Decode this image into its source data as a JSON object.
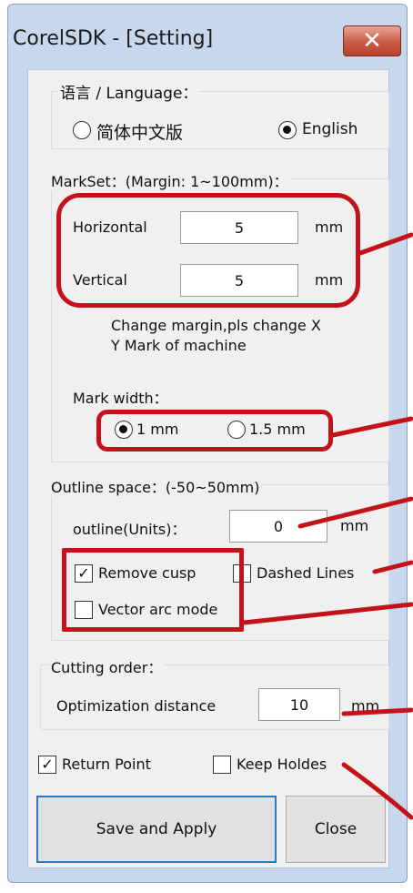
{
  "window": {
    "title": "CorelSDK - [Setting]",
    "close_glyph": "✕"
  },
  "language": {
    "group_label": "语言 / Language：",
    "options": [
      {
        "label": "简体中文版",
        "selected": false
      },
      {
        "label": "English",
        "selected": true
      }
    ]
  },
  "markset": {
    "group_label": "MarkSet：(Margin: 1~100mm)：",
    "horizontal_label": "Horizontal",
    "horizontal_value": "5",
    "vertical_label": "Vertical",
    "vertical_value": "5",
    "unit": "mm",
    "note_line1": "Change margin,pls change X",
    "note_line2": "Y Mark of machine",
    "mark_width_label": "Mark width：",
    "mark_width_options": [
      {
        "label": "1 mm",
        "selected": true
      },
      {
        "label": "1.5 mm",
        "selected": false
      }
    ]
  },
  "outline": {
    "group_label": "Outline space：(-50~50mm)",
    "units_label": "outline(Units)：",
    "units_value": "0",
    "unit": "mm",
    "remove_cusp": {
      "label": "Remove cusp",
      "checked": true
    },
    "dashed_lines": {
      "label": "Dashed Lines",
      "checked": false
    },
    "vector_arc": {
      "label": "Vector arc mode",
      "checked": false
    }
  },
  "cutting": {
    "group_label": "Cutting order：",
    "distance_label": "Optimization distance",
    "distance_value": "10",
    "unit": "mm"
  },
  "return_point": {
    "label": "Return Point",
    "checked": true
  },
  "keep_holdes": {
    "label": "Keep Holdes",
    "checked": false
  },
  "buttons": {
    "save": "Save and Apply",
    "close": "Close"
  },
  "colors": {
    "annotation": "#c4121a",
    "titlebar": "#c8d8ec",
    "primary_border": "#2b78c5"
  }
}
